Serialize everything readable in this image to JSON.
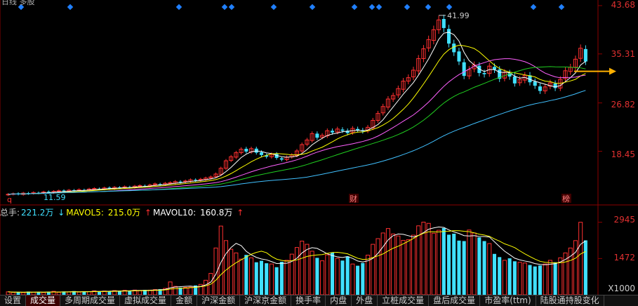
{
  "chart_title": "日线 多股",
  "price_axis": {
    "labels": [
      "43.68",
      "35.31",
      "26.82",
      "18.45"
    ],
    "values": [
      43.68,
      35.31,
      26.82,
      18.45
    ],
    "min": 10.0,
    "max": 43.68
  },
  "annotations": {
    "high": "41.99",
    "low": "11.59",
    "fin_marker": "财",
    "bang_marker": "榜",
    "q_marker": "q"
  },
  "volume_info": {
    "total_label": "总手:",
    "total_value": "221.2万",
    "mavol5_arrow": "↓",
    "mavol5_label": "MAVOL5:",
    "mavol5_value": "215.0万",
    "mavol10_label": "MAVOL10:",
    "mavol10_value": "160.8万",
    "mavol10_arrow": "↑"
  },
  "volume_axis": {
    "labels": [
      "2945",
      "1472"
    ],
    "unit": "X1000"
  },
  "tabs": [
    {
      "label": "设置",
      "active": false
    },
    {
      "label": "成交量",
      "active": true
    },
    {
      "label": "多周期成交量",
      "active": false
    },
    {
      "label": "虚拟成交量",
      "active": false
    },
    {
      "label": "金额",
      "active": false
    },
    {
      "label": "沪深金额",
      "active": false
    },
    {
      "label": "沪深京金额",
      "active": false
    },
    {
      "label": "换手率",
      "active": false
    },
    {
      "label": "内盘",
      "active": false
    },
    {
      "label": "外盘",
      "active": false
    },
    {
      "label": "立桩成交量",
      "active": false
    },
    {
      "label": "盘后成交量",
      "active": false
    },
    {
      "label": "市盈率(ttm)",
      "active": false
    },
    {
      "label": "陆股通持股变化",
      "active": false
    }
  ],
  "colors": {
    "up": "#ff3030",
    "down": "#40e0ff",
    "ma5": "#ffffff",
    "ma10": "#ffff00",
    "ma20": "#ff60ff",
    "ma30": "#20d020",
    "ma60": "#40c0ff",
    "arrow": "#ffb000",
    "diamond": "#2080ff"
  },
  "chart_data": {
    "type": "candlestick",
    "price_ylim": [
      10.0,
      43.68
    ],
    "close": [
      11.0,
      11.1,
      11.0,
      11.2,
      11.1,
      11.3,
      11.2,
      11.4,
      11.3,
      11.5,
      11.6,
      11.5,
      11.7,
      11.6,
      11.8,
      11.7,
      11.9,
      12.0,
      11.9,
      12.1,
      12.0,
      12.2,
      12.1,
      12.3,
      12.2,
      12.4,
      12.5,
      12.4,
      12.6,
      12.8,
      12.7,
      12.9,
      13.0,
      13.2,
      13.1,
      13.3,
      13.5,
      13.4,
      13.6,
      13.8,
      14.0,
      14.5,
      15.5,
      16.8,
      17.5,
      18.2,
      18.8,
      18.4,
      18.9,
      18.2,
      17.8,
      17.5,
      17.9,
      17.3,
      17.0,
      17.4,
      17.8,
      18.5,
      19.6,
      20.4,
      21.5,
      20.8,
      21.2,
      22.0,
      21.7,
      22.3,
      22.0,
      21.6,
      22.4,
      22.1,
      21.9,
      22.6,
      23.8,
      25.0,
      26.2,
      27.5,
      28.1,
      29.3,
      30.6,
      31.2,
      32.5,
      34.5,
      36.2,
      37.8,
      39.5,
      41.2,
      39.8,
      37.1,
      35.6,
      34.0,
      31.5,
      32.6,
      33.4,
      32.0,
      31.8,
      33.2,
      32.6,
      31.0,
      32.1,
      31.4,
      30.2,
      30.9,
      31.6,
      30.4,
      29.8,
      28.9,
      29.6,
      30.3,
      29.4,
      30.9,
      32.4,
      33.0,
      34.4,
      36.3,
      34.0
    ],
    "volume": [
      120,
      95,
      110,
      88,
      130,
      102,
      115,
      90,
      125,
      140,
      98,
      135,
      112,
      150,
      108,
      142,
      128,
      160,
      138,
      152,
      145,
      170,
      158,
      182,
      165,
      190,
      175,
      200,
      188,
      210,
      230,
      260,
      520,
      340,
      290,
      300,
      310,
      380,
      420,
      590,
      870,
      1900,
      2790,
      2200,
      1850,
      1700,
      1450,
      1620,
      1500,
      1320,
      1380,
      1280,
      1250,
      1120,
      1340,
      1400,
      1650,
      1920,
      2180,
      2050,
      1770,
      1500,
      1380,
      1620,
      1710,
      1480,
      1390,
      1560,
      1250,
      1180,
      1290,
      1610,
      2050,
      2280,
      2510,
      2690,
      2470,
      2390,
      2210,
      2240,
      2420,
      2800,
      2950,
      2900,
      2500,
      2620,
      2710,
      2440,
      2480,
      2200,
      2180,
      2630,
      2510,
      2330,
      2180,
      2080,
      1660,
      1530,
      1400,
      1480,
      1360,
      1320,
      1290,
      1210,
      1150,
      1190,
      1250,
      1400,
      1320,
      1500,
      1700,
      1900,
      2200,
      2945,
      2210
    ]
  }
}
